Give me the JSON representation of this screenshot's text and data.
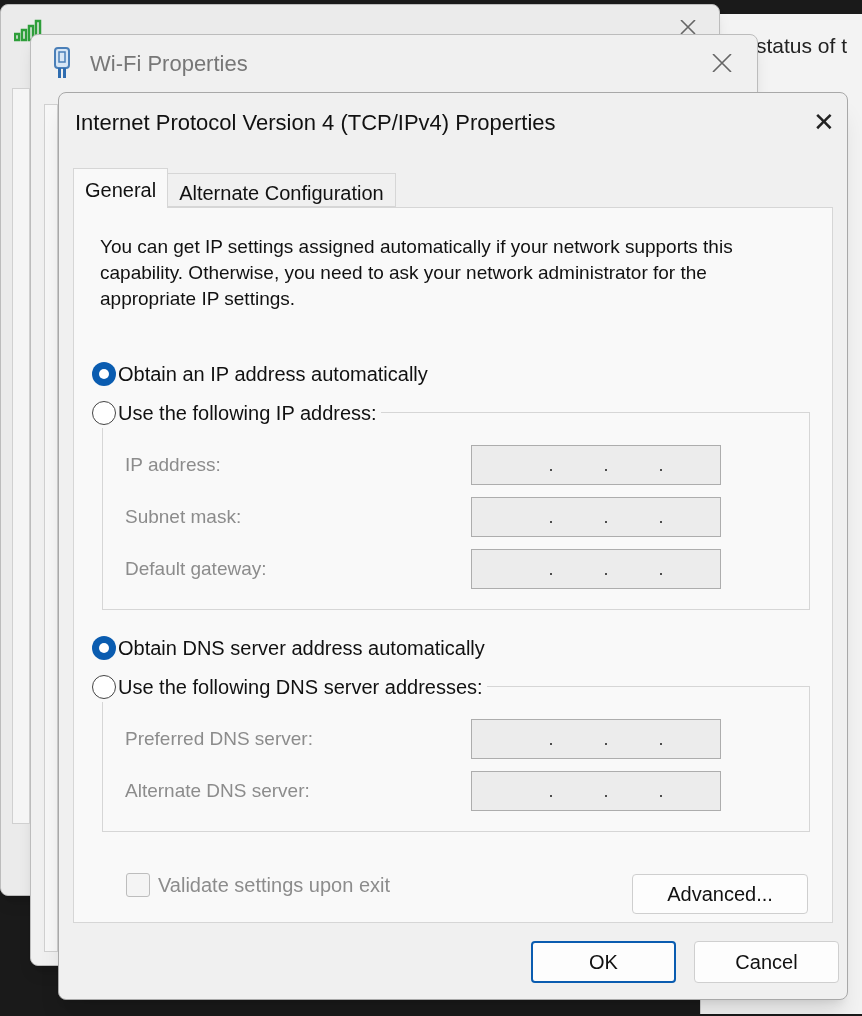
{
  "background_windows": [
    {
      "title": "Wi-Fi Properties"
    }
  ],
  "side_window": {
    "text": "status of t"
  },
  "dialog": {
    "title": "Internet Protocol Version 4 (TCP/IPv4) Properties",
    "close": "✕"
  },
  "tabs": [
    {
      "label": "General",
      "selected": true
    },
    {
      "label": "Alternate Configuration",
      "selected": false
    }
  ],
  "intro": "You can get IP settings assigned automatically if your network supports this capability. Otherwise, you need to ask your network administrator for the appropriate IP settings.",
  "ip_section": {
    "options": [
      {
        "label": "Obtain an IP address automatically",
        "selected": true
      },
      {
        "label": "Use the following IP address:",
        "selected": false
      }
    ],
    "fields": [
      {
        "label": "IP address:",
        "disabled": true,
        "dots": [
          ".",
          ".",
          "."
        ]
      },
      {
        "label": "Subnet mask:",
        "disabled": true,
        "dots": [
          ".",
          ".",
          "."
        ]
      },
      {
        "label": "Default gateway:",
        "disabled": true,
        "dots": [
          ".",
          ".",
          "."
        ]
      }
    ]
  },
  "dns_section": {
    "options": [
      {
        "label": "Obtain DNS server address automatically",
        "selected": true
      },
      {
        "label": "Use the following DNS server addresses:",
        "selected": false
      }
    ],
    "fields": [
      {
        "label": "Preferred DNS server:",
        "disabled": true,
        "dots": [
          ".",
          ".",
          "."
        ]
      },
      {
        "label": "Alternate DNS server:",
        "disabled": true,
        "dots": [
          ".",
          ".",
          "."
        ]
      }
    ]
  },
  "validate": {
    "label": "Validate settings upon exit",
    "checked": false,
    "disabled": true
  },
  "advanced_button": "Advanced...",
  "buttons": [
    {
      "label": "OK",
      "default": true
    },
    {
      "label": "Cancel",
      "default": false
    }
  ]
}
